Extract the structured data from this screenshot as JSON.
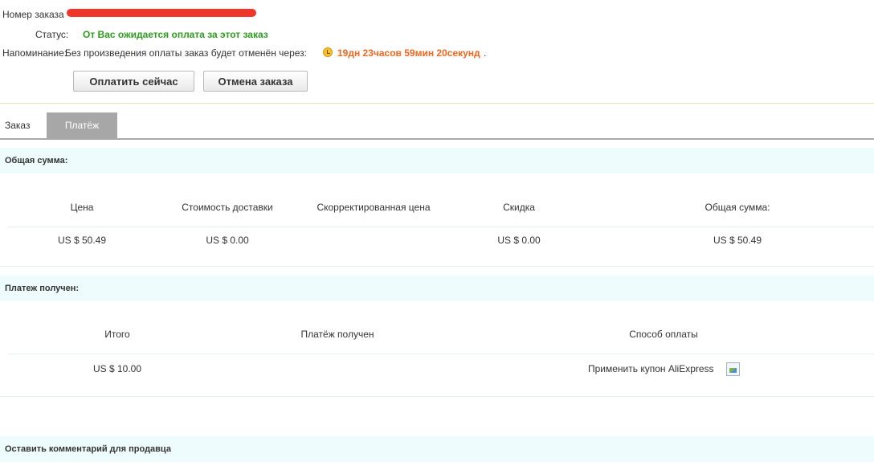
{
  "order": {
    "number_label": "Номер заказа",
    "status_label": "Статус:",
    "status_value": "От Вас ожидается оплата за этот заказ",
    "reminder_label": "Напоминание:",
    "reminder_text": "Без произведения оплаты заказ будет отменён через:",
    "countdown": "19дн 23часов 59мин 20секунд",
    "countdown_suffix": ".",
    "colors": {
      "status": "#2e9d1f",
      "countdown": "#f2661f"
    }
  },
  "actions": {
    "pay_now": "Оплатить сейчас",
    "cancel_order": "Отмена заказа"
  },
  "tabs": [
    {
      "label": "Заказ",
      "active": false
    },
    {
      "label": "Платёж",
      "active": true
    }
  ],
  "total_section": {
    "title": "Общая сумма:",
    "headers": [
      "Цена",
      "Стоимость доставки",
      "Скорректированная цена",
      "Скидка",
      "Общая сумма:"
    ],
    "values": [
      "US $ 50.49",
      "US $ 0.00",
      "",
      "US $ 0.00",
      "US $ 50.49"
    ]
  },
  "payment_section": {
    "title": "Платеж получен:",
    "headers": [
      "Итого",
      "Платёж получен",
      "Способ оплаты"
    ],
    "values": [
      "US $ 10.00",
      "",
      "Применить купон AliExpress"
    ]
  },
  "comment_section": {
    "title": "Оставить комментарий для продавца"
  }
}
